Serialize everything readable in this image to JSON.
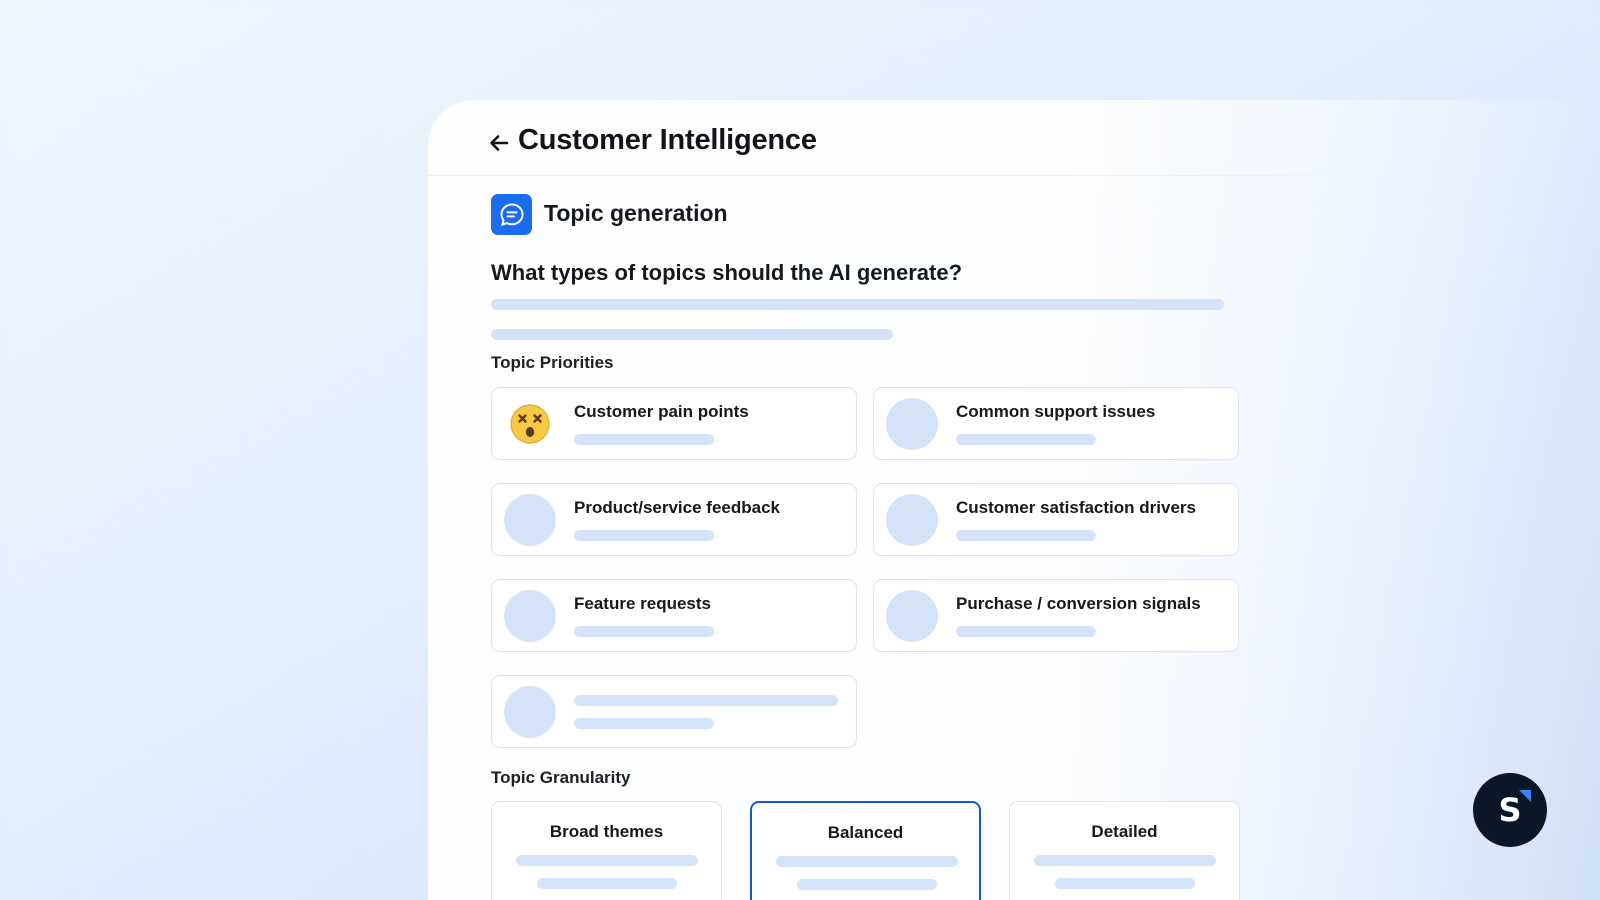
{
  "header": {
    "title": "Customer Intelligence",
    "back_icon": "arrow-left-icon"
  },
  "section": {
    "title": "Topic generation",
    "icon": "chat-bubble-icon",
    "accent": "#1a6cf0"
  },
  "question": "What types of topics should the AI generate?",
  "priorities": {
    "label": "Topic Priorities",
    "items": [
      {
        "title": "Customer pain points",
        "icon": "dizzy-face-emoji-icon"
      },
      {
        "title": "Common support issues"
      },
      {
        "title": "Product/service feedback"
      },
      {
        "title": "Customer satisfaction drivers"
      },
      {
        "title": "Feature requests"
      },
      {
        "title": "Purchase / conversion signals"
      },
      {
        "title": ""
      }
    ]
  },
  "granularity": {
    "label": "Topic Granularity",
    "options": [
      {
        "title": "Broad themes",
        "selected": false
      },
      {
        "title": "Balanced",
        "selected": true
      },
      {
        "title": "Detailed",
        "selected": false
      }
    ],
    "selected_border": "#1a56c9"
  },
  "avatar": {
    "letter": "S",
    "background": "#0b1626"
  }
}
